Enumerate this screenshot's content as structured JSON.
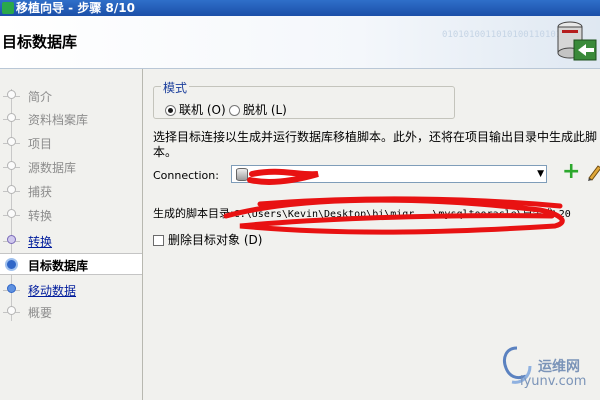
{
  "window": {
    "title": "移植向导 - 步骤 8/10"
  },
  "header": {
    "title": "目标数据库",
    "binary_decoration": "0101010011010100110101010"
  },
  "steps": [
    {
      "label": "简介",
      "state": "disabled"
    },
    {
      "label": "资料档案库",
      "state": "disabled"
    },
    {
      "label": "项目",
      "state": "disabled"
    },
    {
      "label": "源数据库",
      "state": "disabled"
    },
    {
      "label": "捕获",
      "state": "disabled"
    },
    {
      "label": "转换",
      "state": "disabled"
    },
    {
      "label": "转换",
      "state": "visited"
    },
    {
      "label": "目标数据库",
      "state": "active"
    },
    {
      "label": "移动数据",
      "state": "link"
    },
    {
      "label": "概要",
      "state": "disabled"
    }
  ],
  "mode": {
    "legend": "模式",
    "options": [
      {
        "label": "联机 (O)",
        "selected": true
      },
      {
        "label": "脱机 (L)",
        "selected": false
      }
    ]
  },
  "description": "选择目标连接以生成并运行数据库移植脚本。此外，还将在项目输出目录中生成此脚本。",
  "connection": {
    "label": "Connection:",
    "value": ""
  },
  "script_dir": {
    "label": "生成的脚本目录:",
    "path": "C:\\Users\\Kevin\\Desktop\\bi\\migr...\\mysqltooracle\\已生成\\20"
  },
  "drop_target": {
    "label": "删除目标对象 (D)",
    "checked": false
  },
  "watermark": {
    "brand": "运维网",
    "url": "iyunv.com"
  }
}
